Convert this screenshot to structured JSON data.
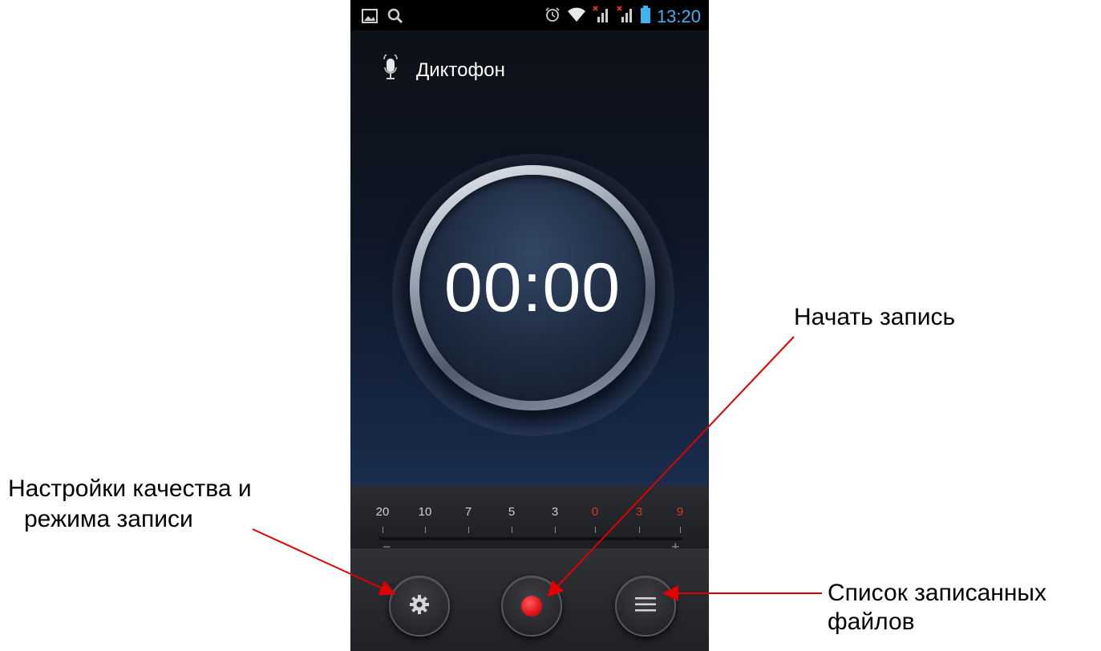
{
  "status_bar": {
    "time": "13:20",
    "left_icons": [
      "gallery-icon",
      "search-icon"
    ],
    "right_icons": [
      "alarm-icon",
      "wifi-icon",
      "signal-sim1-icon",
      "signal-sim2-icon",
      "battery-icon"
    ]
  },
  "app": {
    "title": "Диктофон",
    "icon": "microphone-icon",
    "timer": "00:00"
  },
  "level_meter": {
    "labels": [
      {
        "text": "20",
        "warn": false
      },
      {
        "text": "10",
        "warn": false
      },
      {
        "text": "7",
        "warn": false
      },
      {
        "text": "5",
        "warn": false
      },
      {
        "text": "3",
        "warn": false
      },
      {
        "text": "0",
        "warn": true
      },
      {
        "text": "3",
        "warn": true
      },
      {
        "text": "9",
        "warn": true
      }
    ],
    "minus": "−",
    "plus": "+"
  },
  "controls": {
    "settings": "settings-gear-icon",
    "record": "record-icon",
    "list": "list-icon"
  },
  "annotations": {
    "start_record": "Начать запись",
    "settings_line1": "Настройки качества и",
    "settings_line2": "режима записи",
    "list_line1": "Список записанных",
    "list_line2": "файлов"
  },
  "colors": {
    "accent_blue": "#3fb3ef",
    "record_red": "#e0141b",
    "arrow_red": "#e00000"
  }
}
